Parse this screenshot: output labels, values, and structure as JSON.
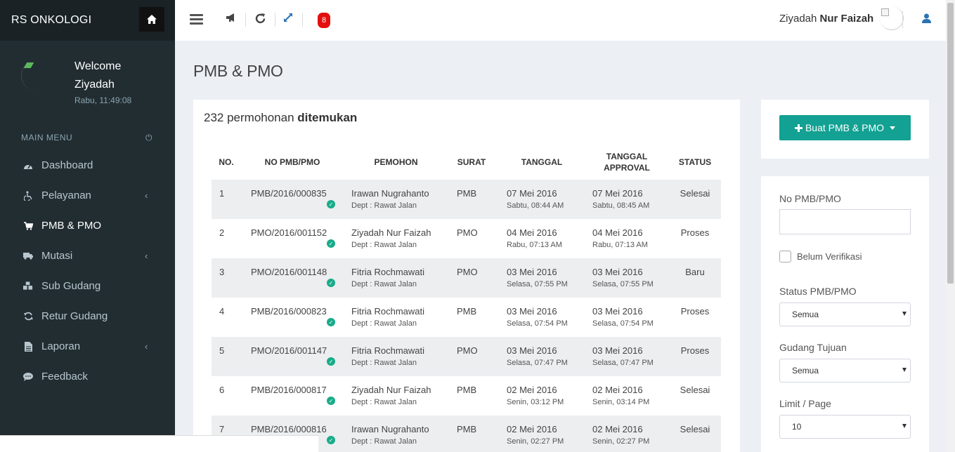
{
  "brand": {
    "name": "RS ONKOLOGI",
    "home_icon": "home-icon"
  },
  "user_panel": {
    "welcome": "Welcome",
    "name": "Ziyadah",
    "clock": "Rabu, 11:49:08"
  },
  "menu": {
    "header": "MAIN MENU",
    "items": [
      {
        "label": "Dashboard",
        "icon": "dashboard-icon",
        "has_submenu": false,
        "active": false
      },
      {
        "label": "Pelayanan",
        "icon": "wheelchair-icon",
        "has_submenu": true,
        "active": false
      },
      {
        "label": "PMB & PMO",
        "icon": "cart-icon",
        "has_submenu": false,
        "active": true
      },
      {
        "label": "Mutasi",
        "icon": "truck-icon",
        "has_submenu": true,
        "active": false
      },
      {
        "label": "Sub Gudang",
        "icon": "cubes-icon",
        "has_submenu": false,
        "active": false
      },
      {
        "label": "Retur Gudang",
        "icon": "refresh-icon",
        "has_submenu": false,
        "active": false
      },
      {
        "label": "Laporan",
        "icon": "file-icon",
        "has_submenu": true,
        "active": false
      },
      {
        "label": "Feedback",
        "icon": "comment-icon",
        "has_submenu": false,
        "active": false
      }
    ]
  },
  "topbar": {
    "notification_count": "8",
    "user_first": "Ziyadah",
    "user_last": "Nur Faizah"
  },
  "page": {
    "title": "PMB & PMO",
    "count_prefix": "232 permohonan",
    "count_suffix": "ditemukan"
  },
  "table": {
    "headers": {
      "no": "NO.",
      "no_pmb": "NO PMB/PMO",
      "pemohon": "PEMOHON",
      "surat": "SURAT",
      "tanggal": "TANGGAL",
      "tanggal_approval_1": "TANGGAL",
      "tanggal_approval_2": "APPROVAL",
      "status": "STATUS"
    },
    "rows": [
      {
        "no": "1",
        "code": "PMB/2016/000835",
        "name": "Irawan Nugrahanto",
        "dept": "Dept : Rawat Jalan",
        "surat": "PMB",
        "date": "07 Mei 2016",
        "date_time": "Sabtu, 08:44 AM",
        "appr": "07 Mei 2016",
        "appr_time": "Sabtu, 08:45 AM",
        "status": "Selesai"
      },
      {
        "no": "2",
        "code": "PMO/2016/001152",
        "name": "Ziyadah Nur Faizah",
        "dept": "Dept : Rawat Jalan",
        "surat": "PMO",
        "date": "04 Mei 2016",
        "date_time": "Rabu, 07:13 AM",
        "appr": "04 Mei 2016",
        "appr_time": "Rabu, 07:13 AM",
        "status": "Proses"
      },
      {
        "no": "3",
        "code": "PMO/2016/001148",
        "name": "Fitria Rochmawati",
        "dept": "Dept : Rawat Jalan",
        "surat": "PMO",
        "date": "03 Mei 2016",
        "date_time": "Selasa, 07:55 PM",
        "appr": "03 Mei 2016",
        "appr_time": "Selasa, 07:55 PM",
        "status": "Baru"
      },
      {
        "no": "4",
        "code": "PMB/2016/000823",
        "name": "Fitria Rochmawati",
        "dept": "Dept : Rawat Jalan",
        "surat": "PMB",
        "date": "03 Mei 2016",
        "date_time": "Selasa, 07:54 PM",
        "appr": "03 Mei 2016",
        "appr_time": "Selasa, 07:54 PM",
        "status": "Proses"
      },
      {
        "no": "5",
        "code": "PMO/2016/001147",
        "name": "Fitria Rochmawati",
        "dept": "Dept : Rawat Jalan",
        "surat": "PMO",
        "date": "03 Mei 2016",
        "date_time": "Selasa, 07:47 PM",
        "appr": "03 Mei 2016",
        "appr_time": "Selasa, 07:47 PM",
        "status": "Proses"
      },
      {
        "no": "6",
        "code": "PMB/2016/000817",
        "name": "Ziyadah Nur Faizah",
        "dept": "Dept : Rawat Jalan",
        "surat": "PMB",
        "date": "02 Mei 2016",
        "date_time": "Senin, 03:12 PM",
        "appr": "02 Mei 2016",
        "appr_time": "Senin, 03:14 PM",
        "status": "Selesai"
      },
      {
        "no": "7",
        "code": "PMB/2016/000816",
        "name": "Irawan Nugrahanto",
        "dept": "Dept : Rawat Jalan",
        "surat": "PMB",
        "date": "02 Mei 2016",
        "date_time": "Senin, 02:27 PM",
        "appr": "02 Mei 2016",
        "appr_time": "Senin, 02:27 PM",
        "status": "Selesai"
      }
    ]
  },
  "side": {
    "create_button": "Buat PMB & PMO",
    "no_label": "No PMB/PMO",
    "no_value": "",
    "unverified_label": "Belum Verifikasi",
    "status_label": "Status PMB/PMO",
    "status_value": "Semua",
    "gudang_label": "Gudang Tujuan",
    "gudang_value": "Semua",
    "limit_label": "Limit / Page",
    "limit_value": "10"
  },
  "colors": {
    "sidebar": "#222d32",
    "accent": "#12a192",
    "notif": "#e30e0e",
    "check": "#1aab8a"
  }
}
